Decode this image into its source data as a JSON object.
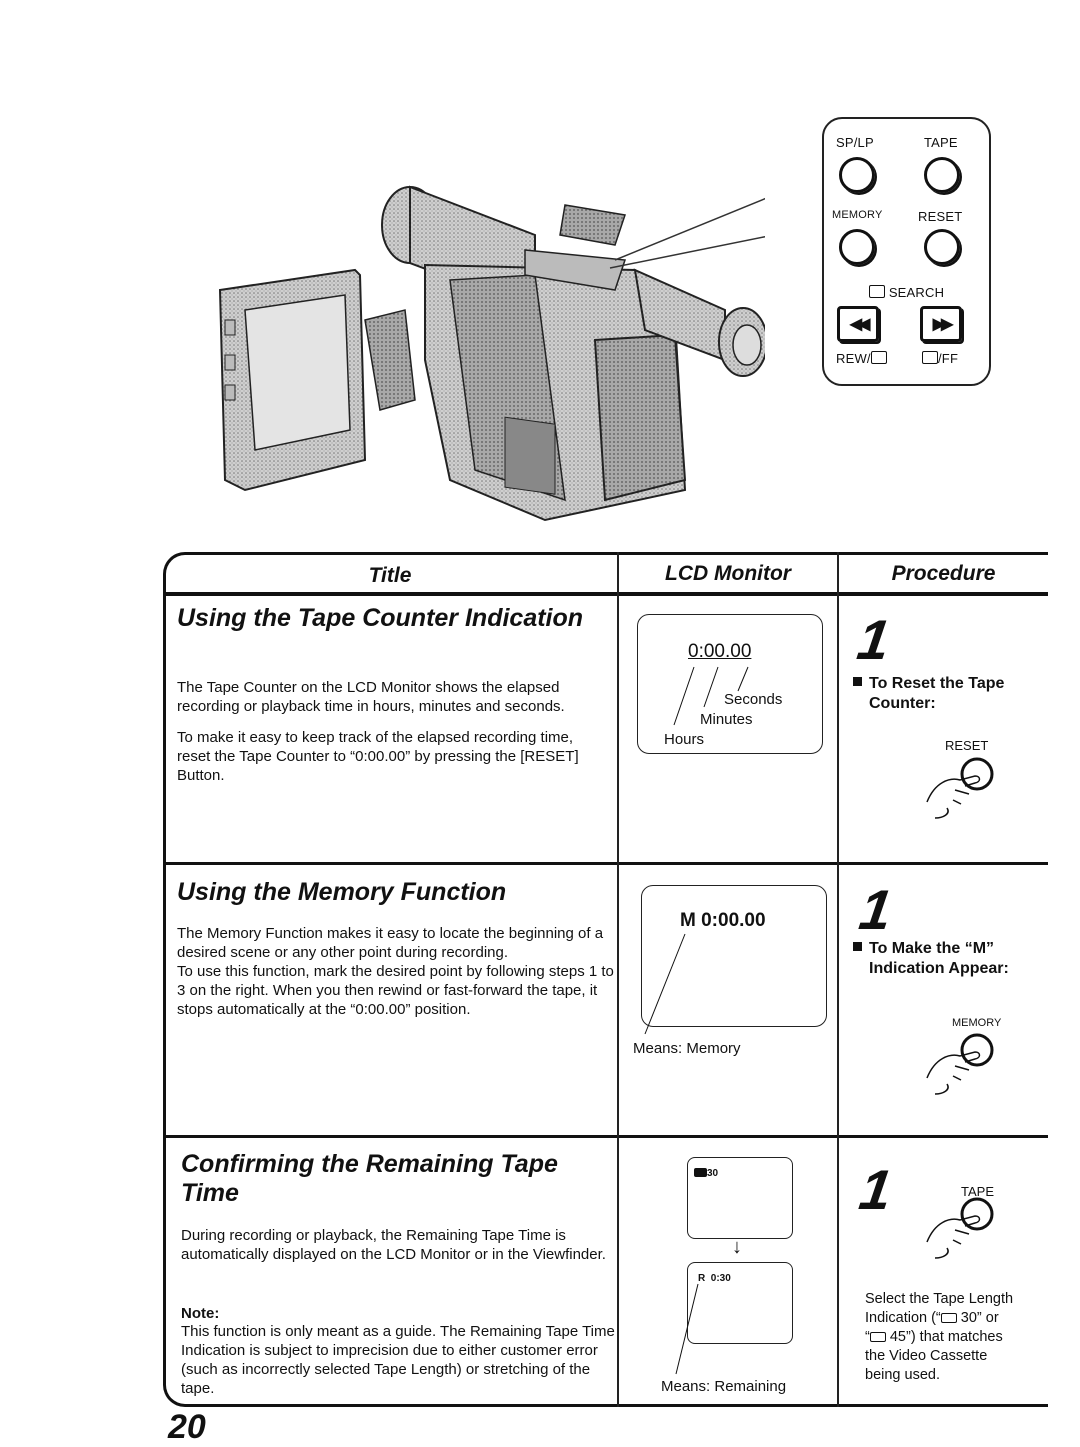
{
  "control_panel": {
    "buttons_row1": [
      "SP/LP",
      "TAPE"
    ],
    "buttons_row2": [
      "MEMORY",
      "RESET"
    ],
    "search_label": "SEARCH",
    "rew_label": "REW/",
    "ff_label": "/FF",
    "rew_symbol": "◀◀",
    "ff_symbol": "▶▶"
  },
  "table": {
    "headers": {
      "title": "Title",
      "lcd": "LCD Monitor",
      "procedure": "Procedure"
    },
    "sections": [
      {
        "title": "Using the Tape Counter Indication",
        "paragraphs": [
          "The Tape Counter on the LCD Monitor shows the elapsed recording or playback time in hours, minutes and seconds.",
          "To make it easy to keep track of the elapsed recording time, reset the Tape Counter to “0:00.00” by pressing the [RESET] Button."
        ],
        "lcd": {
          "display": "0:00.00",
          "labels": [
            "Seconds",
            "Minutes",
            "Hours"
          ]
        },
        "procedure": {
          "step": "1",
          "heading": "To Reset the Tape Counter:",
          "button": "RESET"
        }
      },
      {
        "title": "Using the Memory Function",
        "paragraphs": [
          "The Memory Function makes it easy to locate the beginning of a desired scene or any other point during recording.",
          "To use this function, mark the desired point by following steps 1 to 3 on the right. When you then rewind or fast-forward the tape, it stops automatically at the “0:00.00” position."
        ],
        "lcd": {
          "display": "M  0:00.00",
          "caption": "Means:  Memory"
        },
        "procedure": {
          "step": "1",
          "heading": "To Make the “M” Indication Appear:",
          "button": "MEMORY"
        }
      },
      {
        "title": "Confirming the Remaining Tape Time",
        "paragraphs": [
          "During recording or playback, the Remaining Tape Time is automatically displayed on the LCD Monitor or in the Viewfinder."
        ],
        "note_label": "Note:",
        "note": "This function is only meant as a guide. The Remaining Tape Time Indication is subject to imprecision due to either customer error (such as incorrectly selected Tape Length) or stretching of the tape.",
        "lcd": {
          "display_before": "30",
          "display_after": "R  0:30",
          "caption": "Means:  Remaining",
          "arrow": "↓"
        },
        "procedure": {
          "step": "1",
          "button": "TAPE",
          "instruction_lines": [
            "Select the Tape Length",
            "Indication (“",
            " 30” or",
            "“",
            " 45”) that matches",
            "the Video Cassette",
            "being used."
          ]
        }
      }
    ]
  },
  "page_number": "20"
}
